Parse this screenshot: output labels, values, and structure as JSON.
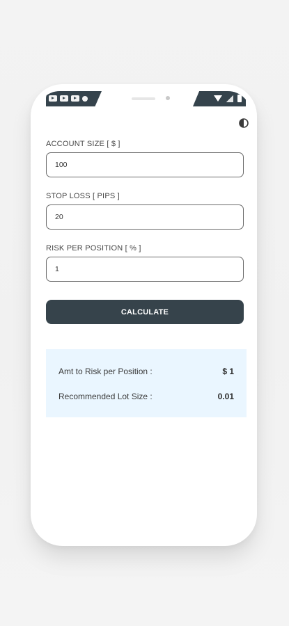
{
  "theme_icon": "half-moon-icon",
  "status_bar": {
    "left_icons": [
      "play-icon",
      "play-icon",
      "play-icon",
      "dot-icon"
    ],
    "right_icons": [
      "wifi-icon",
      "signal-icon",
      "battery-icon"
    ]
  },
  "form": {
    "account_size": {
      "label": "ACCOUNT SIZE [ $ ]",
      "value": "100"
    },
    "stop_loss": {
      "label": "STOP LOSS [ PIPS ]",
      "value": "20"
    },
    "risk_per_position": {
      "label": "RISK PER POSITION [ % ]",
      "value": "1"
    }
  },
  "calculate_label": "CALCULATE",
  "results": {
    "risk_amount": {
      "label": "Amt to Risk per Position :",
      "value": "$ 1"
    },
    "lot_size": {
      "label": "Recommended Lot Size :",
      "value": "0.01"
    }
  },
  "colors": {
    "primary": "#36434b",
    "results_bg": "#eaf6ff",
    "page_bg": "#f2f2f2"
  }
}
